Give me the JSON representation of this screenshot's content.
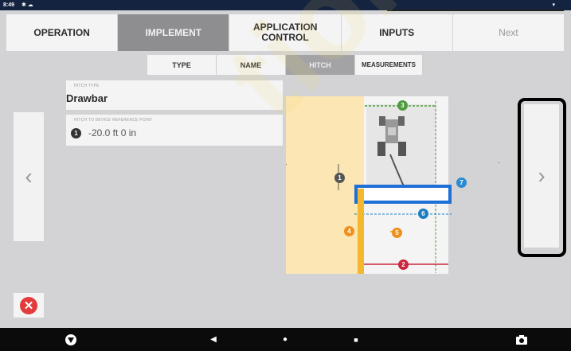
{
  "status_bar": {
    "time": "8:49",
    "icons": "✱ ☁",
    "wifi": "▾"
  },
  "top_tabs": [
    {
      "label": "OPERATION"
    },
    {
      "label": "IMPLEMENT"
    },
    {
      "label": "APPLICATION CONTROL"
    },
    {
      "label": "INPUTS"
    },
    {
      "label": "Next"
    }
  ],
  "sub_tabs": [
    {
      "label": "TYPE"
    },
    {
      "label": "NAME"
    },
    {
      "label": "HITCH"
    },
    {
      "label": "MEASUREMENTS"
    }
  ],
  "fields": {
    "hitch_type": {
      "label": "HITCH TYPE",
      "value": "Drawbar"
    },
    "hitch_offset": {
      "label": "HITCH TO DEVICE REFERENCE POINT",
      "badge": "1",
      "value": "-20.0 ft 0 in"
    }
  },
  "diagram": {
    "badges": {
      "b1": "1",
      "b2": "2",
      "b3": "3",
      "b4": "4",
      "b5": "5",
      "b6": "6",
      "b7": "7"
    }
  },
  "nav": {
    "left_arrow": "‹",
    "right_arrow": "›"
  },
  "cancel_icon": "✕",
  "bottom_bar": {
    "back": "◀",
    "home": "●",
    "recent": "■"
  },
  "watermark": "tions",
  "colors": {
    "active_tab": "#8e8e90",
    "highlight": "#1f6fd6",
    "field": "#fbe6b4"
  }
}
